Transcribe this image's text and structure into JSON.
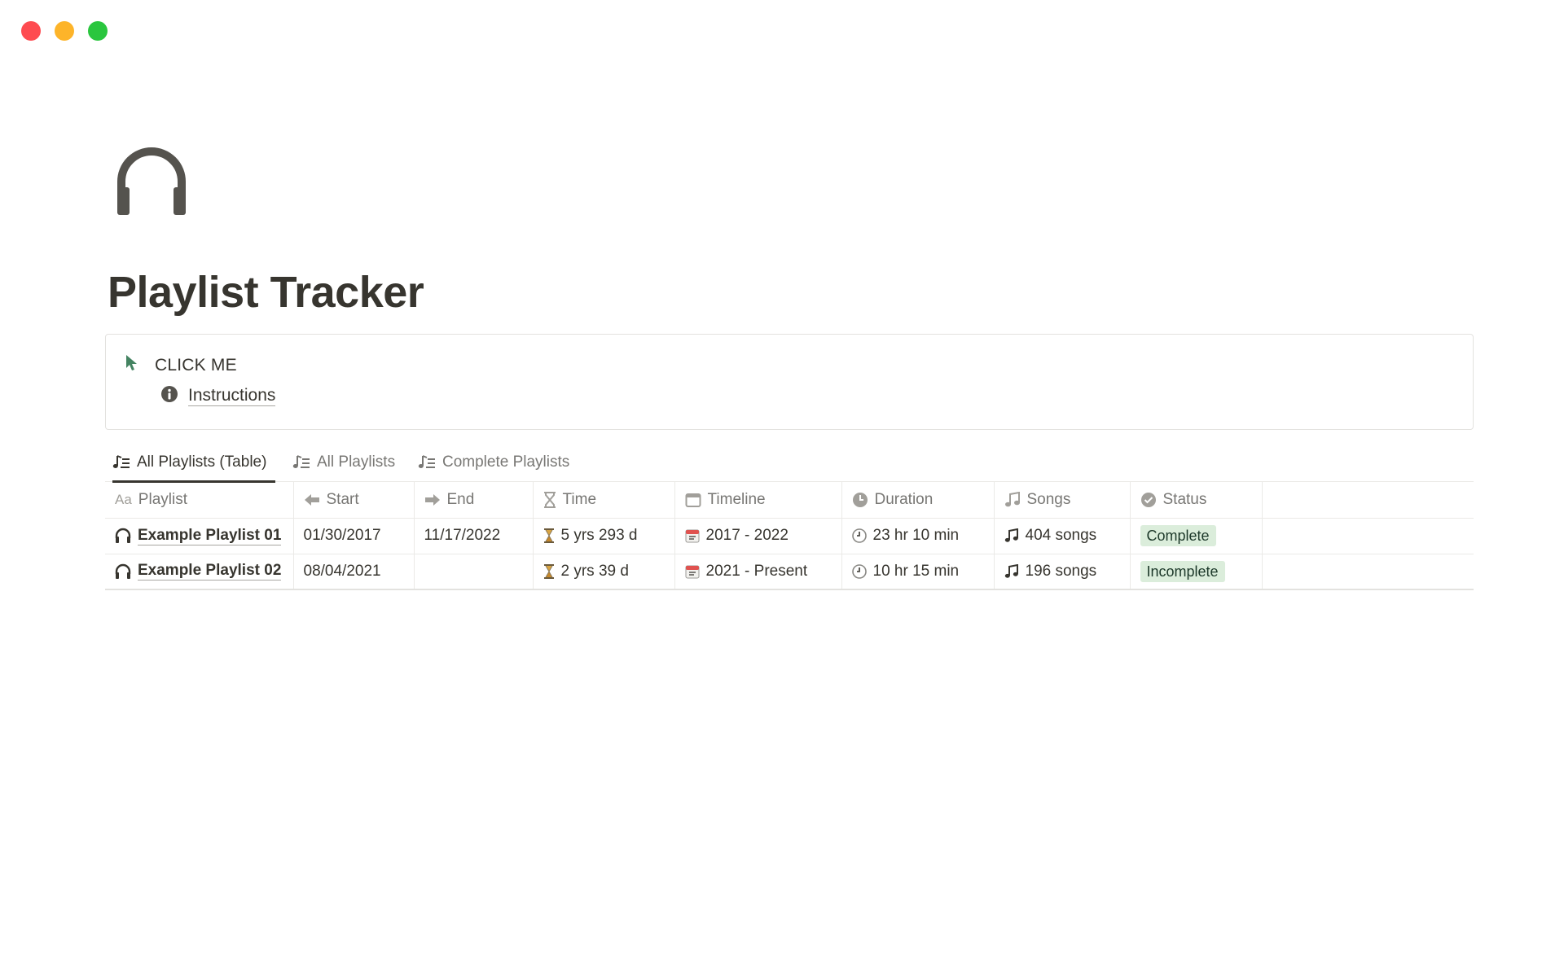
{
  "page": {
    "title": "Playlist Tracker",
    "icon": "headphones-icon"
  },
  "callout": {
    "icon": "cursor-pointer-icon",
    "title": "CLICK ME",
    "link_icon": "info-icon",
    "link_label": "Instructions"
  },
  "tabs": [
    {
      "label": "All Playlists (Table)",
      "icon": "music-list-icon",
      "active": true
    },
    {
      "label": "All Playlists",
      "icon": "music-list-icon",
      "active": false
    },
    {
      "label": "Complete Playlists",
      "icon": "music-list-icon",
      "active": false
    }
  ],
  "table": {
    "columns": [
      {
        "label": "Playlist",
        "icon_text": "Aa"
      },
      {
        "label": "Start",
        "icon": "arrow-left-icon"
      },
      {
        "label": "End",
        "icon": "arrow-right-icon"
      },
      {
        "label": "Time",
        "icon": "hourglass-icon"
      },
      {
        "label": "Timeline",
        "icon": "calendar-icon"
      },
      {
        "label": "Duration",
        "icon": "clock-icon"
      },
      {
        "label": "Songs",
        "icon": "music-note-icon"
      },
      {
        "label": "Status",
        "icon": "check-circle-icon"
      }
    ],
    "rows": [
      {
        "playlist": "Example Playlist 01",
        "start": "01/30/2017",
        "end": "11/17/2022",
        "time": "5 yrs 293 d",
        "timeline": "2017 - 2022",
        "duration": "23 hr 10 min",
        "songs": "404 songs",
        "status": "Complete"
      },
      {
        "playlist": "Example Playlist 02",
        "start": "08/04/2021",
        "end": "",
        "time": "2 yrs 39 d",
        "timeline": "2021 - Present",
        "duration": "10 hr 15 min",
        "songs": "196 songs",
        "status": "Incomplete"
      }
    ]
  },
  "colors": {
    "text": "#37352f",
    "muted": "#787774",
    "accent_green": "#448361",
    "tag_bg": "#dbeddb",
    "traffic_red": "#fe4b50",
    "traffic_yellow": "#fdb429",
    "traffic_green": "#2ac63e"
  }
}
